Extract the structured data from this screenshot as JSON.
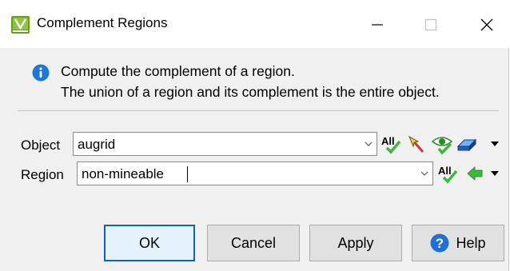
{
  "window": {
    "title": "Complement Regions"
  },
  "info": {
    "line1": "Compute the complement of a region.",
    "line2": "The union of a region and its complement is the entire object."
  },
  "object_row": {
    "label": "Object",
    "value": "augrid",
    "all_label": "All"
  },
  "region_row": {
    "label": "Region",
    "value": "non-mineable",
    "all_label": "All"
  },
  "buttons": {
    "ok": "OK",
    "cancel": "Cancel",
    "apply": "Apply",
    "help": "Help"
  },
  "colors": {
    "accent": "#0a64c8",
    "info_blue": "#1e78d7",
    "check_green": "#3cb83c"
  }
}
